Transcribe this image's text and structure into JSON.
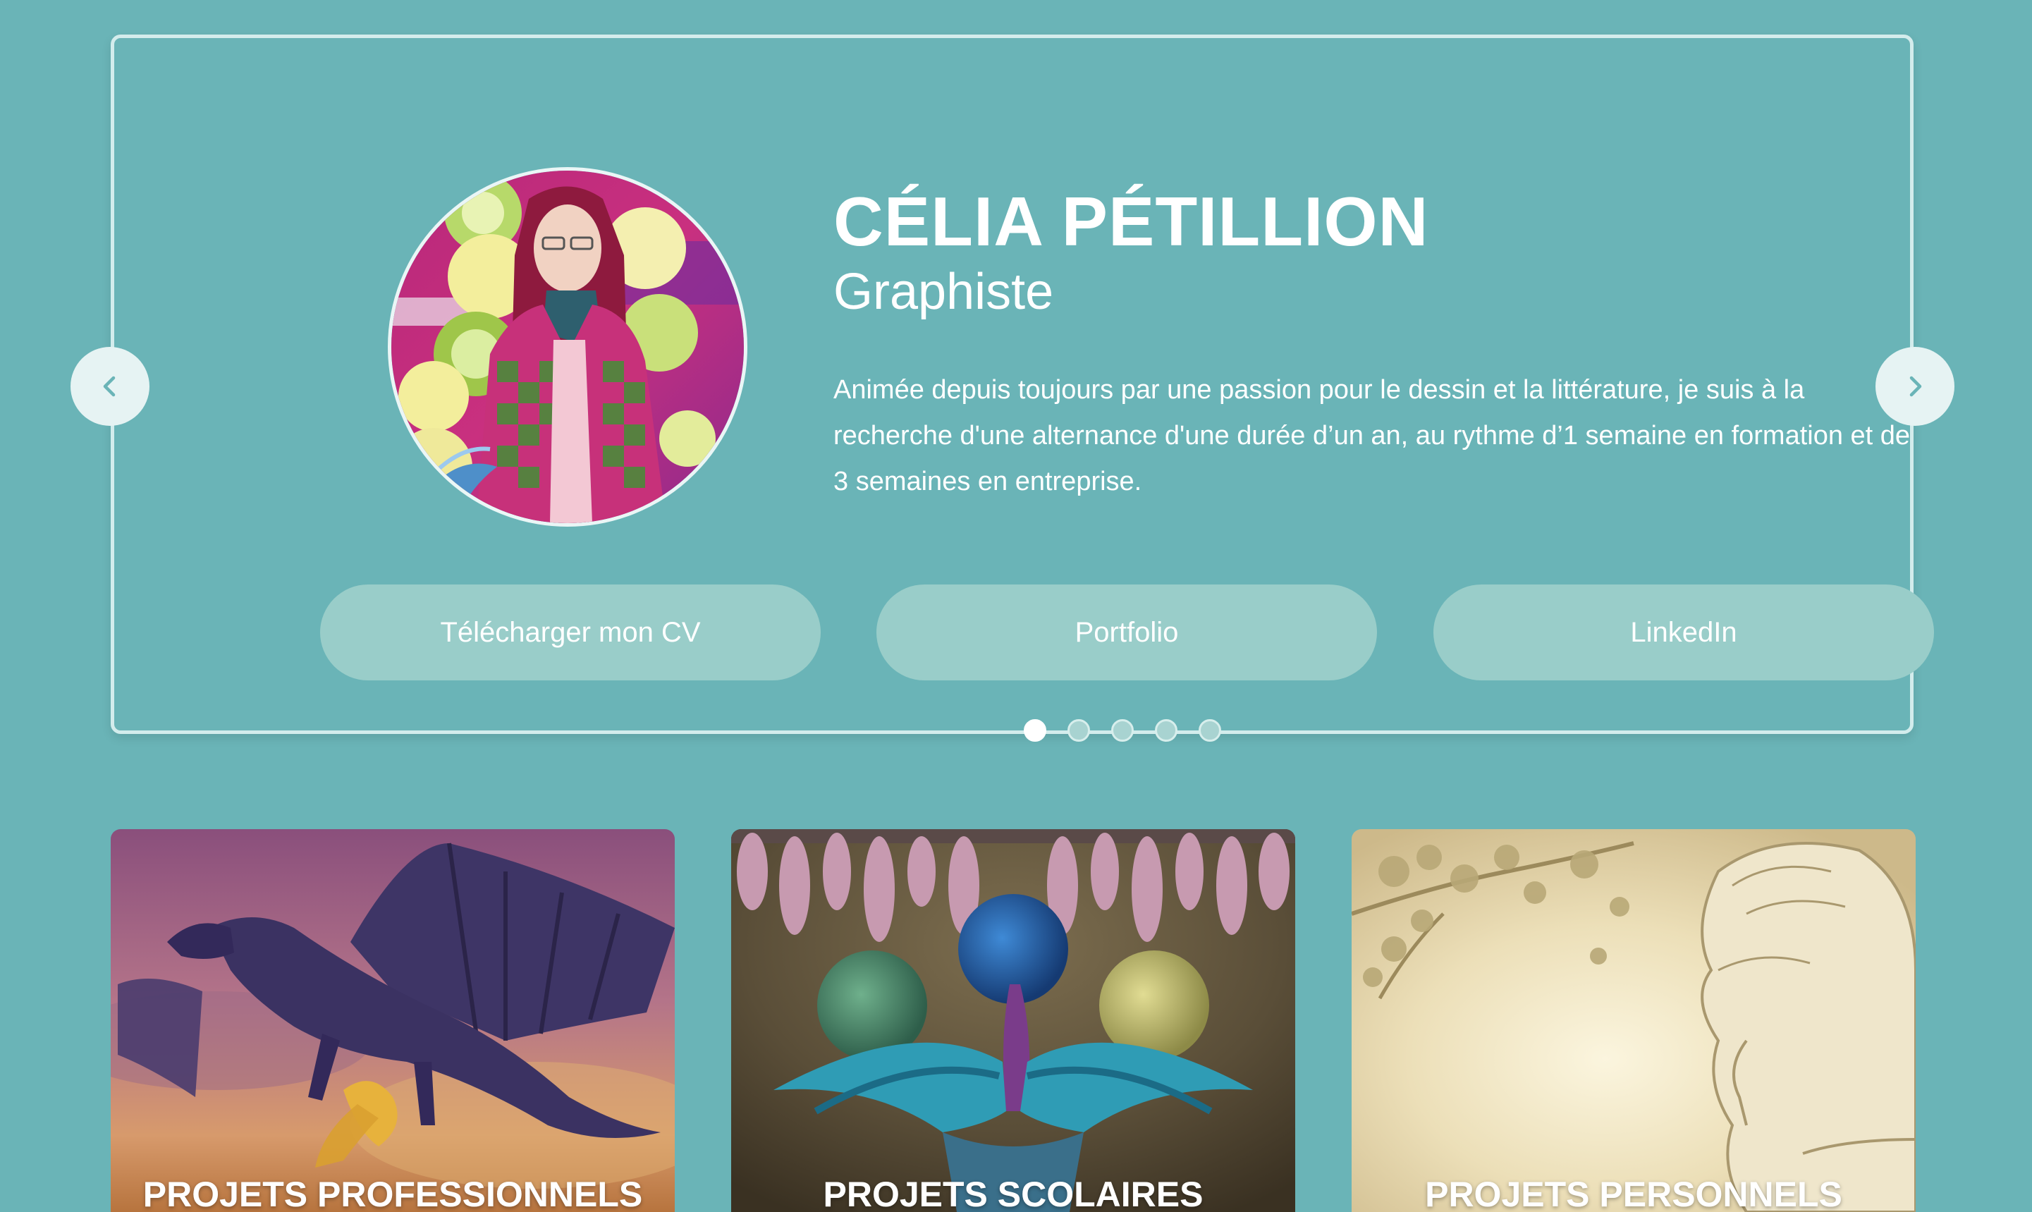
{
  "profile": {
    "name": "CÉLIA PÉTILLION",
    "role": "Graphiste",
    "bio": "Animée depuis toujours par une passion pour le dessin et la littérature, je suis à la recherche d'une alternance d'une durée d’un an, au rythme d’1 semaine en formation et de 3 semaines en entreprise."
  },
  "actions": {
    "cv_label": "Télécharger mon CV",
    "portfolio_label": "Portfolio",
    "linkedin_label": "LinkedIn"
  },
  "carousel": {
    "slide_count": 5,
    "active_index": 0,
    "prev_icon": "chevron-left-icon",
    "next_icon": "chevron-right-icon"
  },
  "projects": [
    {
      "title": "PROJETS PROFESSIONNELS"
    },
    {
      "title": "PROJETS SCOLAIRES"
    },
    {
      "title": "PROJETS PERSONNELS"
    }
  ],
  "colors": {
    "background": "#6ab4b7",
    "button": "#99cdc9",
    "text": "#ffffff"
  }
}
